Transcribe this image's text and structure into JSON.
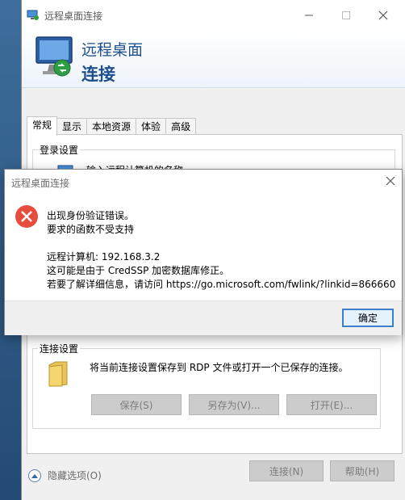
{
  "main_window": {
    "title": "远程桌面连接",
    "banner_line1": "远程桌面",
    "banner_line2": "连接"
  },
  "tabs": [
    "常规",
    "显示",
    "本地资源",
    "体验",
    "高级"
  ],
  "login_group": {
    "label": "登录设置",
    "desc": "输入远程计算机的名称。"
  },
  "connection_group": {
    "label": "连接设置",
    "desc": "将当前连接设置保存到 RDP 文件或打开一个已保存的连接。",
    "save": "保存(S)",
    "save_as": "另存为(V)...",
    "open": "打开(E)..."
  },
  "bottom": {
    "hide_options": "隐藏选项(O)",
    "connect": "连接(N)",
    "help": "帮助(H)"
  },
  "dialog": {
    "title": "远程桌面连接",
    "line1": "出现身份验证错误。",
    "line2": "要求的函数不受支持",
    "line3": "远程计算机: 192.168.3.2",
    "line4": "这可能是由于 CredSSP 加密数据库修正。",
    "line5": "若要了解详细信息，请访问 https://go.microsoft.com/fwlink/?linkid=866660",
    "ok": "确定"
  },
  "colors": {
    "accent": "#3c7fcb",
    "banner_text": "#1e4f8c",
    "error_red": "#e74c3c"
  }
}
